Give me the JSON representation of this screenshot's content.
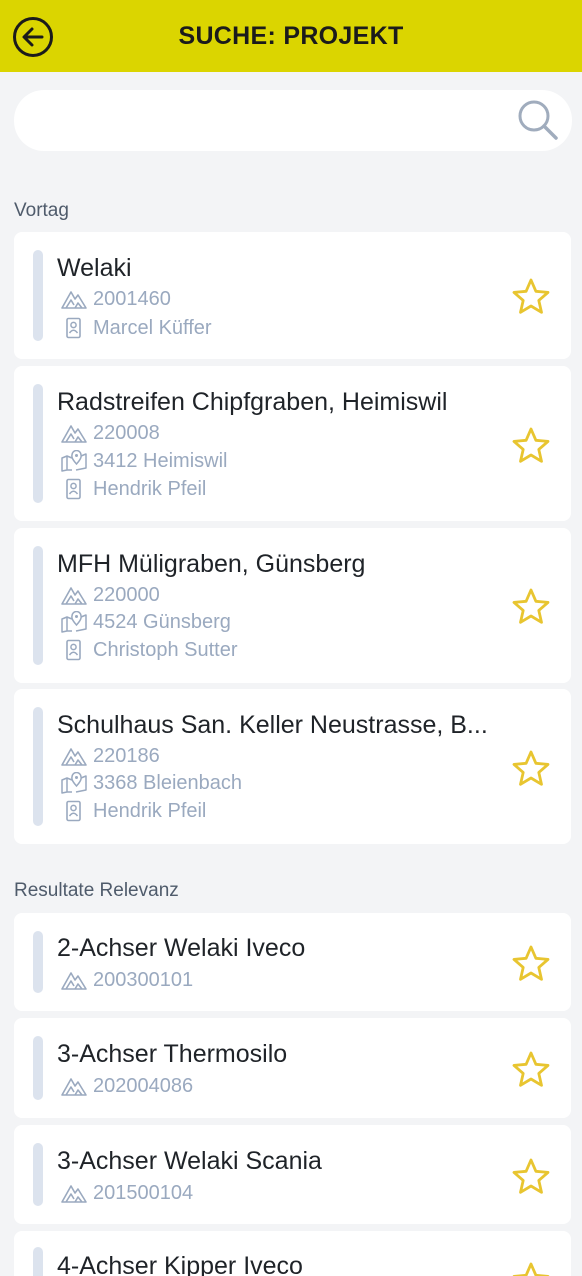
{
  "header": {
    "title": "SUCHE: PROJEKT"
  },
  "search": {
    "value": "",
    "placeholder": ""
  },
  "sections": {
    "vortag": "Vortag",
    "relevanz": "Resultate Relevanz"
  },
  "vortag_cards": [
    {
      "title": "Welaki",
      "number": "2001460",
      "person": "Marcel Küffer"
    },
    {
      "title": "Radstreifen Chipfgraben, Heimiswil",
      "number": "220008",
      "place": "3412 Heimiswil",
      "person": "Hendrik Pfeil"
    },
    {
      "title": "MFH Müligraben, Günsberg",
      "number": "220000",
      "place": "4524 Günsberg",
      "person": "Christoph Sutter"
    },
    {
      "title": "Schulhaus San. Keller Neustrasse, B...",
      "number": "220186",
      "place": "3368 Bleienbach",
      "person": "Hendrik Pfeil"
    }
  ],
  "relevanz_cards": [
    {
      "title": "2-Achser Welaki Iveco",
      "number": "200300101"
    },
    {
      "title": "3-Achser Thermosilo",
      "number": "202004086"
    },
    {
      "title": "3-Achser Welaki Scania",
      "number": "201500104"
    },
    {
      "title": "4-Achser Kipper Iveco"
    }
  ],
  "colors": {
    "header": "#dbd500",
    "star": "#e8c530",
    "meta": "#9aa9bf",
    "accent_bar": "#dce3ee"
  },
  "icons": {
    "back": "arrow-left-circle-icon",
    "search": "search-icon",
    "project": "terrain-icon",
    "place": "map-pin-icon",
    "person": "person-badge-icon",
    "favorite": "star-outline-icon"
  }
}
